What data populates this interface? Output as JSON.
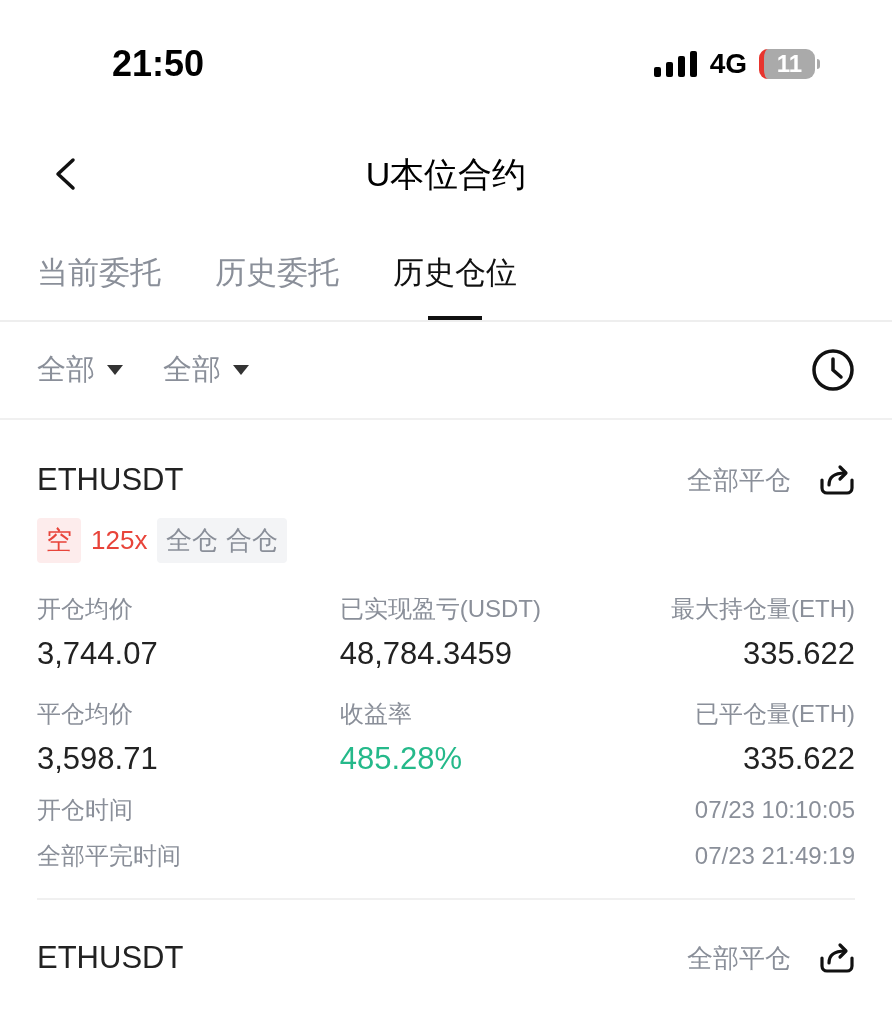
{
  "status_bar": {
    "time": "21:50",
    "network": "4G",
    "battery": "11"
  },
  "header": {
    "title": "U本位合约"
  },
  "tabs": [
    {
      "label": "当前委托",
      "selected": false
    },
    {
      "label": "历史委托",
      "selected": false
    },
    {
      "label": "历史仓位",
      "selected": true
    }
  ],
  "filters": [
    {
      "label": "全部"
    },
    {
      "label": "全部"
    }
  ],
  "positions": [
    {
      "symbol": "ETHUSDT",
      "close_all": "全部平仓",
      "side": "空",
      "leverage": "125x",
      "margin_tag": "全仓 合仓",
      "stats": [
        {
          "label": "开仓均价",
          "value": "3,744.07",
          "kind": "plain"
        },
        {
          "label": "已实现盈亏(USDT)",
          "value": "48,784.3459",
          "kind": "plain"
        },
        {
          "label": "最大持仓量(ETH)",
          "value": "335.622",
          "kind": "plain"
        },
        {
          "label": "平仓均价",
          "value": "3,598.71",
          "kind": "plain"
        },
        {
          "label": "收益率",
          "value": "485.28%",
          "kind": "profit"
        },
        {
          "label": "已平仓量(ETH)",
          "value": "335.622",
          "kind": "plain"
        }
      ],
      "times": [
        {
          "label": "开仓时间",
          "value": "07/23 10:10:05"
        },
        {
          "label": "全部平完时间",
          "value": "07/23 21:49:19"
        }
      ]
    },
    {
      "symbol": "ETHUSDT",
      "close_all": "全部平仓"
    }
  ]
}
